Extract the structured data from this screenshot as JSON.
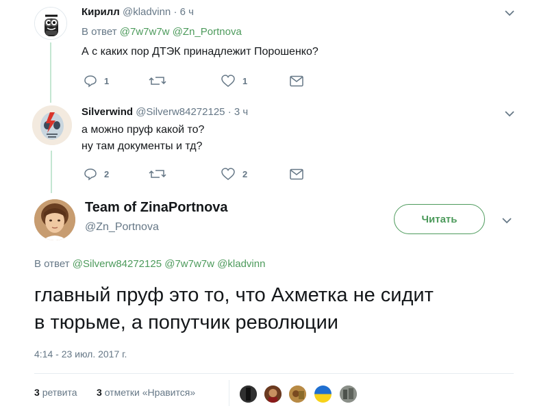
{
  "tweets": [
    {
      "name": "Кирилл",
      "handle": "@kladvinn",
      "time": "· 6 ч",
      "reply_prefix": "В ответ",
      "reply_mentions": [
        "@7w7w7w",
        "@Zn_Portnova"
      ],
      "text": "А с каких пор ДТЭК принадлежит Порошенко?",
      "replies": "1",
      "retweets": "",
      "likes": "1"
    },
    {
      "name": "Silverwind",
      "handle": "@Silverw84272125",
      "time": "· 3 ч",
      "lines": [
        "а можно пруф какой то?",
        "ну там документы и тд?"
      ],
      "replies": "2",
      "retweets": "",
      "likes": "2"
    }
  ],
  "main_tweet": {
    "name": "Team of ZinaPortnova",
    "handle": "@Zn_Portnova",
    "follow_label": "Читать",
    "reply_prefix": "В ответ",
    "reply_mentions": [
      "@Silverw84272125",
      "@7w7w7w",
      "@kladvinn"
    ],
    "text_line1": "главный пруф это то, что Ахметка не сидит",
    "text_line2": "в тюрьме, а попутчик революции",
    "timestamp": "4:14 - 23 июл. 2017 г.",
    "retweet_count": "3",
    "retweet_label": "ретвита",
    "like_count": "3",
    "like_label": "отметки «Нравится»"
  },
  "colors": {
    "accent_green": "#4c9a5b",
    "thread_line": "#c3e6d1",
    "muted": "#657786"
  },
  "icons": [
    "chevron-down-icon",
    "reply-icon",
    "retweet-icon",
    "like-icon",
    "dm-icon"
  ]
}
